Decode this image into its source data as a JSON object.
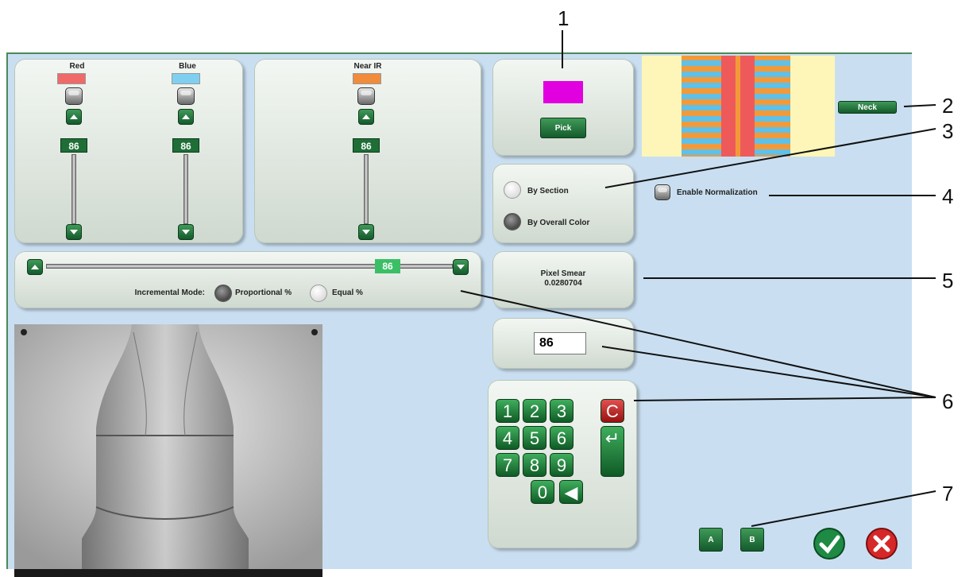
{
  "rgb_panel": {
    "red_label": "Red",
    "blue_label": "Blue",
    "red_color": "#f06a6a",
    "blue_color": "#7fd0f0",
    "red_value": "86",
    "blue_value": "86"
  },
  "nir_panel": {
    "label": "Near IR",
    "color": "#f08c3c",
    "value": "86"
  },
  "pick_panel": {
    "pick_label": "Pick",
    "picked_color": "#e000e0"
  },
  "neck_label": "Neck",
  "mode_panel": {
    "by_section": "By Section",
    "by_overall": "By Overall Color",
    "by_section_selected": false,
    "by_overall_selected": true
  },
  "normalization_label": "Enable Normalization",
  "horizontal_slider": {
    "value": "86",
    "incremental_label": "Incremental Mode:",
    "proportional": "Proportional %",
    "equal": "Equal %"
  },
  "pixel_smear": {
    "title": "Pixel Smear",
    "value": "0.0280704"
  },
  "entry_value": "86",
  "keypad": {
    "keys": [
      "1",
      "2",
      "3",
      "C",
      "4",
      "5",
      "6",
      "7",
      "8",
      "9",
      "0"
    ]
  },
  "ab_buttons": {
    "a": "A",
    "b": "B"
  },
  "annotations": [
    "1",
    "2",
    "3",
    "4",
    "5",
    "6",
    "7"
  ]
}
